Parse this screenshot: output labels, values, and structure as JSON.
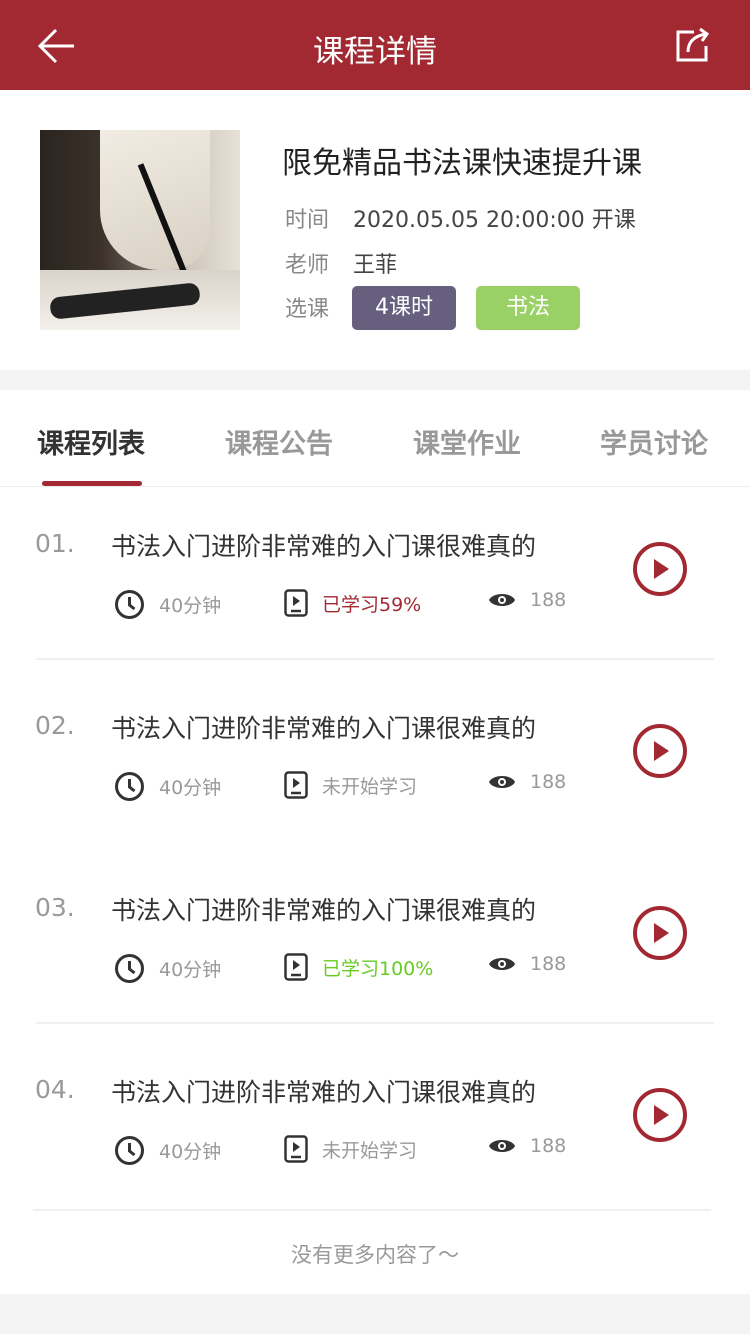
{
  "header": {
    "title": "课程详情"
  },
  "course": {
    "title": "限免精品书法课快速提升课",
    "time_label": "时间",
    "time_value": "2020.05.05 20:00:00 开课",
    "teacher_label": "老师",
    "teacher_value": "王菲",
    "select_label": "选课",
    "tags": [
      {
        "text": "4课时",
        "color": "#66607e"
      },
      {
        "text": "书法",
        "color": "#99d166"
      }
    ]
  },
  "tabs": [
    {
      "label": "课程列表"
    },
    {
      "label": "课程公告"
    },
    {
      "label": "课堂作业"
    },
    {
      "label": "学员讨论"
    }
  ],
  "lessons": [
    {
      "num": "01.",
      "title": "书法入门进阶非常难的入门课很难真的",
      "duration": "40分钟",
      "status": "已学习59%",
      "status_color": "#a22832",
      "views": "188"
    },
    {
      "num": "02.",
      "title": "书法入门进阶非常难的入门课很难真的",
      "duration": "40分钟",
      "status": "未开始学习",
      "status_color": "#999999",
      "views": "188"
    },
    {
      "num": "03.",
      "title": "书法入门进阶非常难的入门课很难真的",
      "duration": "40分钟",
      "status": "已学习100%",
      "status_color": "#66cc22",
      "views": "188"
    },
    {
      "num": "04.",
      "title": "书法入门进阶非常难的入门课很难真的",
      "duration": "40分钟",
      "status": "未开始学习",
      "status_color": "#999999",
      "views": "188"
    }
  ],
  "footer": {
    "text": "没有更多内容了～"
  },
  "colors": {
    "brand": "#a22832"
  }
}
